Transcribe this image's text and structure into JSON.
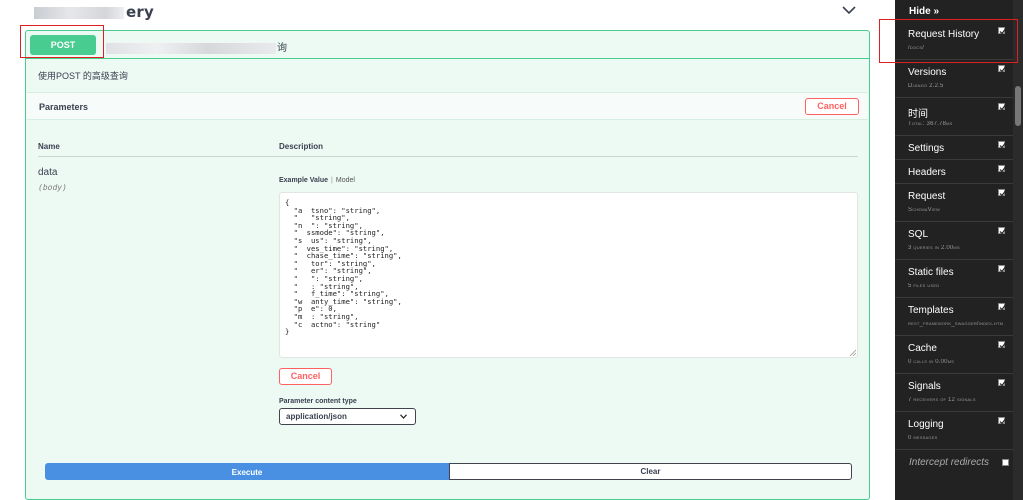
{
  "section": {
    "title_suffix": "ery"
  },
  "operation": {
    "method": "POST",
    "path_suffix": "询",
    "description": "使用POST 的高级查询"
  },
  "parameters": {
    "title": "Parameters",
    "cancel_label": "Cancel",
    "col_name": "Name",
    "col_description": "Description",
    "param": {
      "name": "data",
      "in": "(body)"
    },
    "tab_example": "Example Value",
    "tab_separator": "|",
    "tab_model": "Model",
    "example_json": "{\n  \"a  tsno\": \"string\",\n  \"   \"string\",\n  \"n  \": \"string\",\n  \"  ssmode\": \"string\",\n  \"s  us\": \"string\",\n  \"  ves_time\": \"string\",\n  \"  chase_time\": \"string\",\n  \"   tor\": \"string\",\n  \"   er\": \"string\",\n  \"   \": \"string\",\n  \"   : \"string\",\n  \"   f_time\": \"string\",\n  \"w  anty_time\": \"string\",\n  \"p  e\": 0,\n  \"m  : \"string\",\n  \"c  actno\": \"string\"\n}",
    "body_cancel_label": "Cancel",
    "content_type_label": "Parameter content type",
    "content_type_value": "application/json"
  },
  "actions": {
    "execute_label": "Execute",
    "clear_label": "Clear"
  },
  "toolbar": {
    "hide_label": "Hide »",
    "panels": [
      {
        "title": "Request History",
        "subtitle": "/docs/"
      },
      {
        "title": "Versions",
        "subtitle": "Django 2.2.5"
      },
      {
        "title": "时间",
        "subtitle": "Total: 367.78ms"
      },
      {
        "title": "Settings",
        "subtitle": ""
      },
      {
        "title": "Headers",
        "subtitle": ""
      },
      {
        "title": "Request",
        "subtitle": "SchemaView"
      },
      {
        "title": "SQL",
        "subtitle": "3 queries in 2.00ms"
      },
      {
        "title": "Static files",
        "subtitle": "5 files used"
      },
      {
        "title": "Templates",
        "subtitle": "rest_framework_swagger/index.htm"
      },
      {
        "title": "Cache",
        "subtitle": "0 calls in 0.00ms"
      },
      {
        "title": "Signals",
        "subtitle": "7 receivers of 12 signals"
      },
      {
        "title": "Logging",
        "subtitle": "0 messages"
      }
    ],
    "intercept_label": "Intercept redirects"
  },
  "colors": {
    "post_green": "#49cc90",
    "execute_blue": "#4990e2",
    "cancel_red": "#ff6060",
    "toolbar_bg": "#222222",
    "annotation_red": "#e02020"
  }
}
